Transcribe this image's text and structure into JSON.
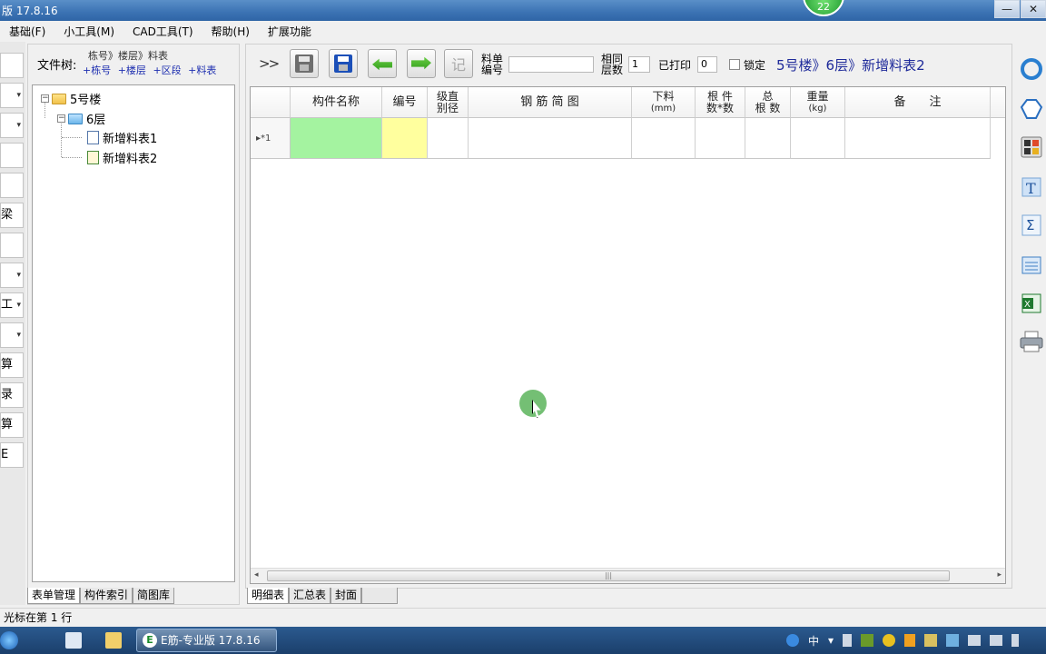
{
  "window": {
    "title": "版 17.8.16",
    "badge": "22",
    "minimize": "—",
    "close": "✕"
  },
  "menu": [
    "基础(F)",
    "小工具(M)",
    "CAD工具(T)",
    "帮助(H)",
    "扩展功能"
  ],
  "left_strip": {
    "items": [
      {
        "label": "",
        "dropdown": false
      },
      {
        "label": "",
        "dropdown": true
      },
      {
        "label": "",
        "dropdown": true
      },
      {
        "label": "",
        "dropdown": false
      },
      {
        "label": "",
        "dropdown": false
      },
      {
        "label": "梁",
        "dropdown": false
      },
      {
        "label": "",
        "dropdown": false
      },
      {
        "label": "",
        "dropdown": true
      },
      {
        "label": "工",
        "dropdown": true
      },
      {
        "label": "",
        "dropdown": true
      },
      {
        "label": "算",
        "dropdown": false
      },
      {
        "label": "录",
        "dropdown": false
      },
      {
        "label": "算",
        "dropdown": false
      },
      {
        "label": "E",
        "dropdown": false
      }
    ]
  },
  "tree_panel": {
    "label": "文件树:",
    "path": "栋号》楼层》料表",
    "links": [
      "+栋号",
      "+楼层",
      "+区段",
      "+料表"
    ],
    "nodes": {
      "building": "5号楼",
      "floor": "6层",
      "sheet1": "新增料表1",
      "sheet2": "新增料表2"
    },
    "tabs": [
      "表单管理",
      "构件索引",
      "简图库"
    ]
  },
  "toolbar": {
    "expand": ">>",
    "record_btn": "记",
    "sheet_no_label": [
      "料单",
      "编号"
    ],
    "sheet_no_value": "",
    "same_floors_label": [
      "相同",
      "层数"
    ],
    "same_floors_value": "1",
    "printed_label": "已打印",
    "printed_value": "0",
    "lock_label": "锁定",
    "breadcrumb": "5号楼》6层》新增料表2"
  },
  "grid": {
    "columns": [
      {
        "label": "构件名称"
      },
      {
        "label": "编号"
      },
      {
        "label": "级直",
        "sub": "别径"
      },
      {
        "label": "钢 筋 简 图"
      },
      {
        "label": "下料",
        "sub": "(mm)"
      },
      {
        "label": "根 件",
        "sub": "数*数"
      },
      {
        "label": "总",
        "sub": "根 数"
      },
      {
        "label": "重量",
        "sub": "(kg)"
      },
      {
        "label": "备　　注"
      }
    ],
    "rows": [
      {
        "marker": "▸*1",
        "cells": [
          "",
          "",
          "",
          "",
          "",
          "",
          "",
          "",
          ""
        ]
      }
    ],
    "scroll_grip": "|||",
    "scroll_left": "◂",
    "scroll_right": "▸"
  },
  "main_tabs": [
    "明细表",
    "汇总表",
    "封面"
  ],
  "status": "光标在第 1 行",
  "taskbar": {
    "app_label": "E筋-专业版 17.8.16",
    "app_icon": "E",
    "tray": [
      "中",
      "▾"
    ]
  },
  "colors": {
    "name_cell": "#a4f3a0",
    "code_cell": "#ffff9e",
    "breadcrumb": "#1e2a9a"
  }
}
